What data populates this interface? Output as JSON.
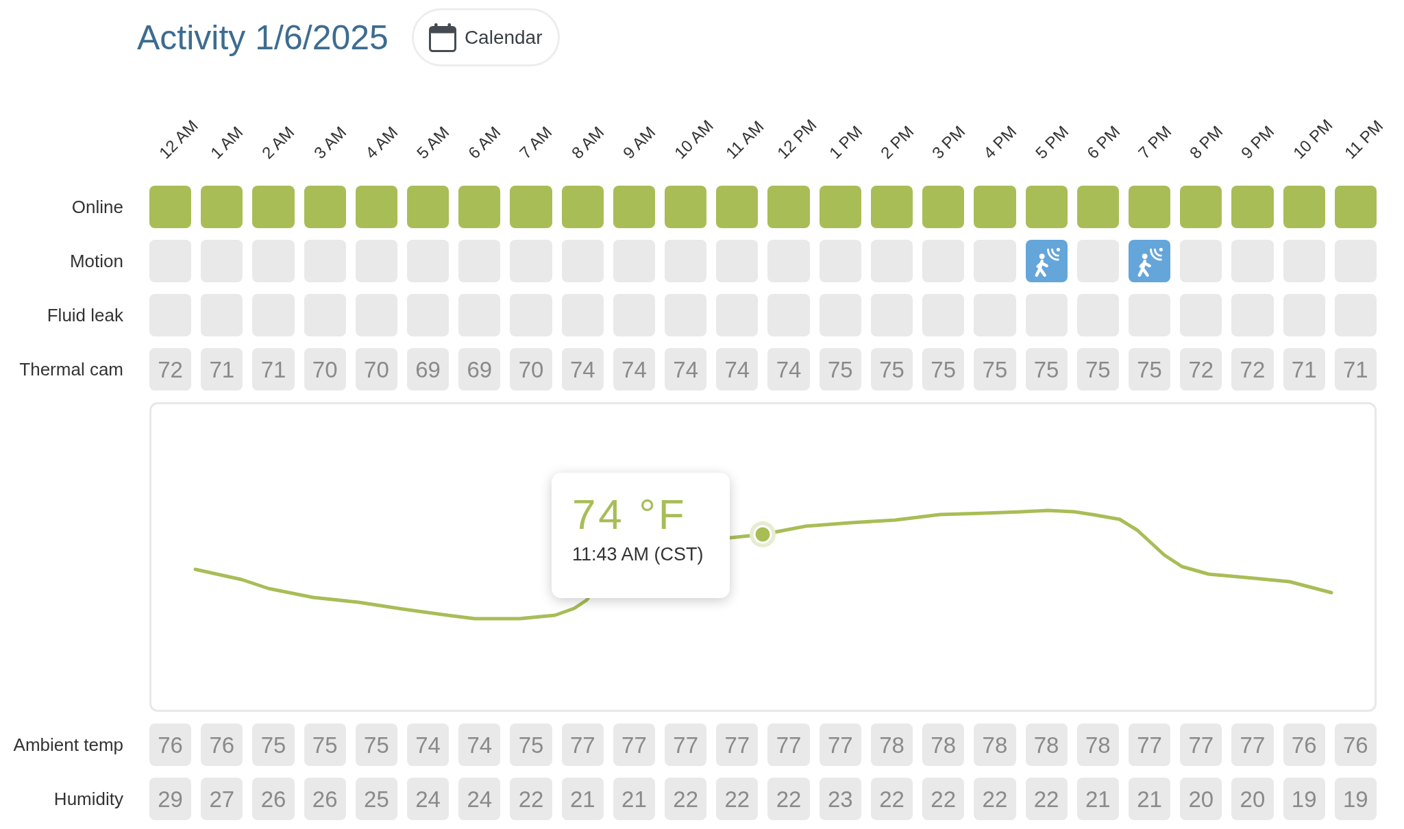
{
  "header": {
    "title": "Activity 1/6/2025",
    "calendar_button": {
      "label": "Calendar"
    }
  },
  "hours": [
    "12 AM",
    "1 AM",
    "2 AM",
    "3 AM",
    "4 AM",
    "5 AM",
    "6 AM",
    "7 AM",
    "8 AM",
    "9 AM",
    "10 AM",
    "11 AM",
    "12 PM",
    "1 PM",
    "2 PM",
    "3 PM",
    "4 PM",
    "5 PM",
    "6 PM",
    "7 PM",
    "8 PM",
    "9 PM",
    "10 PM",
    "11 PM"
  ],
  "rows": [
    {
      "kind": "status",
      "label": "Online",
      "cells": [
        {
          "on": true
        },
        {
          "on": true
        },
        {
          "on": true
        },
        {
          "on": true
        },
        {
          "on": true
        },
        {
          "on": true
        },
        {
          "on": true
        },
        {
          "on": true
        },
        {
          "on": true
        },
        {
          "on": true
        },
        {
          "on": true
        },
        {
          "on": true
        },
        {
          "on": true
        },
        {
          "on": true
        },
        {
          "on": true
        },
        {
          "on": true
        },
        {
          "on": true
        },
        {
          "on": true
        },
        {
          "on": true
        },
        {
          "on": true
        },
        {
          "on": true
        },
        {
          "on": true
        },
        {
          "on": true
        },
        {
          "on": true
        }
      ]
    },
    {
      "kind": "motion",
      "label": "Motion",
      "cells": [
        {
          "detected": false
        },
        {
          "detected": false
        },
        {
          "detected": false
        },
        {
          "detected": false
        },
        {
          "detected": false
        },
        {
          "detected": false
        },
        {
          "detected": false
        },
        {
          "detected": false
        },
        {
          "detected": false
        },
        {
          "detected": false
        },
        {
          "detected": false
        },
        {
          "detected": false
        },
        {
          "detected": false
        },
        {
          "detected": false
        },
        {
          "detected": false
        },
        {
          "detected": false
        },
        {
          "detected": false
        },
        {
          "detected": true
        },
        {
          "detected": false
        },
        {
          "detected": true
        },
        {
          "detected": false
        },
        {
          "detected": false
        },
        {
          "detected": false
        },
        {
          "detected": false
        }
      ]
    },
    {
      "kind": "leak",
      "label": "Fluid leak",
      "cells": [
        {
          "detected": false
        },
        {
          "detected": false
        },
        {
          "detected": false
        },
        {
          "detected": false
        },
        {
          "detected": false
        },
        {
          "detected": false
        },
        {
          "detected": false
        },
        {
          "detected": false
        },
        {
          "detected": false
        },
        {
          "detected": false
        },
        {
          "detected": false
        },
        {
          "detected": false
        },
        {
          "detected": false
        },
        {
          "detected": false
        },
        {
          "detected": false
        },
        {
          "detected": false
        },
        {
          "detected": false
        },
        {
          "detected": false
        },
        {
          "detected": false
        },
        {
          "detected": false
        },
        {
          "detected": false
        },
        {
          "detected": false
        },
        {
          "detected": false
        },
        {
          "detected": false
        }
      ]
    },
    {
      "kind": "value",
      "label": "Thermal cam",
      "cells": [
        "72",
        "71",
        "71",
        "70",
        "70",
        "69",
        "69",
        "70",
        "74",
        "74",
        "74",
        "74",
        "74",
        "75",
        "75",
        "75",
        "75",
        "75",
        "75",
        "75",
        "72",
        "72",
        "71",
        "71"
      ]
    },
    {
      "kind": "chart",
      "tooltip": {
        "value": "74 °F",
        "time": "11:43 AM (CST)"
      }
    },
    {
      "kind": "value",
      "label": "Ambient temp",
      "cells": [
        "76",
        "76",
        "75",
        "75",
        "75",
        "74",
        "74",
        "75",
        "77",
        "77",
        "77",
        "77",
        "77",
        "77",
        "78",
        "78",
        "78",
        "78",
        "78",
        "77",
        "77",
        "77",
        "76",
        "76"
      ]
    },
    {
      "kind": "value",
      "label": "Humidity",
      "cells": [
        "29",
        "27",
        "26",
        "26",
        "25",
        "24",
        "24",
        "22",
        "21",
        "21",
        "22",
        "22",
        "22",
        "23",
        "22",
        "22",
        "22",
        "22",
        "21",
        "21",
        "20",
        "20",
        "19",
        "19"
      ]
    }
  ]
}
